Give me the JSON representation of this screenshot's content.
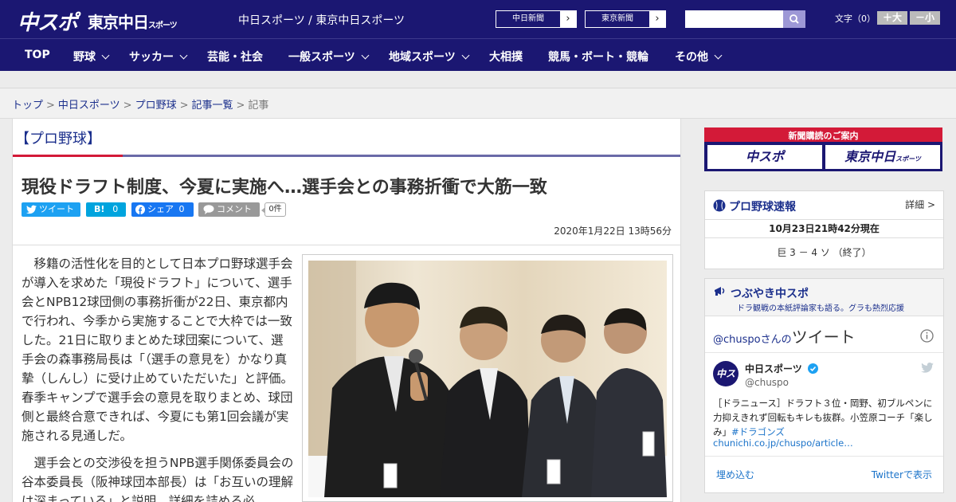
{
  "header": {
    "logo_chuspo": "中スポ",
    "logo_tokyo": "東京中日",
    "logo_tokyo_small": "スポーツ",
    "site_title": "中日スポーツ / 東京中日スポーツ",
    "btn_chunichi": "中日新聞",
    "btn_tokyo": "東京新聞",
    "search_placeholder": "",
    "font_label": "文字（0）",
    "font_bigger": "＋大",
    "font_smaller": "－小"
  },
  "nav": [
    {
      "label": "TOP"
    },
    {
      "label": "野球"
    },
    {
      "label": "サッカー"
    },
    {
      "label": "芸能・社会"
    },
    {
      "label": "一般スポーツ"
    },
    {
      "label": "地域スポーツ"
    },
    {
      "label": "大相撲"
    },
    {
      "label": "競馬・ボート・競輪"
    },
    {
      "label": "その他"
    }
  ],
  "breadcrumb": {
    "items": [
      "トップ",
      "中日スポーツ",
      "プロ野球",
      "記事一覧",
      "記事"
    ],
    "separator": ">"
  },
  "article": {
    "category": "【プロ野球】",
    "headline": "現役ドラフト制度、今夏に実施へ…選手会との事務折衝で大筋一致",
    "share": {
      "tweet": "ツイート",
      "hatena_label": "B!",
      "hatena_count": "0",
      "facebook": "シェア",
      "facebook_count": "0",
      "comment": "コメント",
      "comment_count": "0件"
    },
    "date": "2020年1月22日 13時56分",
    "paragraphs": [
      "移籍の活性化を目的として日本プロ野球選手会が導入を求めた「現役ドラフト」について、選手会とNPB12球団側の事務折衝が22日、東京都内で行われ、今季から実施することで大枠では一致した。21日に取りまとめた球団案について、選手会の森事務局長は「（選手の意見を）かなり真摯（しんし）に受け止めていただいた」と評価。春季キャンプで選手会の意見を取りまとめ、球団側と最終合意できれば、今夏にも第1回会議が実施される見通しだ。",
      "選手会との交渉役を担うNPB選手関係委員会の谷本委員長（阪神球団本部長）は「お互いの理解は深まっている」と説明。詳細を詰める必"
    ]
  },
  "sidebar": {
    "ad_title": "新聞購読のご案内",
    "ad_logo_1": "中スポ",
    "ad_logo_2": "東京中日",
    "ad_logo_2_small": "スポーツ",
    "score": {
      "title": "プロ野球速報",
      "detail": "詳細 >",
      "time": "10月23日21時42分現在",
      "line": "巨 3 － 4 ソ （終了）"
    },
    "twitter": {
      "title": "つぶやき中スポ",
      "subtitle": "ドラ観戦の本紙評論家も語る。グラも熱烈応援",
      "handle": "@chuspo",
      "handle_suffix": "さんの",
      "tweets_label": "ツイート",
      "avatar_text": "中スポ",
      "account_name": "中日スポーツ",
      "account_user": "@chuspo",
      "tweet_text": "［ドラニュース］ドラフト３位・岡野、初ブルペンに力抑えきれず回転もキレも抜群。小笠原コーチ「楽しみ」",
      "tweet_tag": "#ドラゴンズ",
      "tweet_link": "chunichi.co.jp/chuspo/article…",
      "embed": "埋め込む",
      "view_on_twitter": "Twitterで表示"
    }
  },
  "colors": {
    "header_navy": "#1b1772",
    "accent_red": "#d31a38",
    "link_blue": "#1b2f8c",
    "twitter_blue": "#1da1f2",
    "facebook_blue": "#1877f2",
    "hatena_blue": "#00a4de"
  }
}
